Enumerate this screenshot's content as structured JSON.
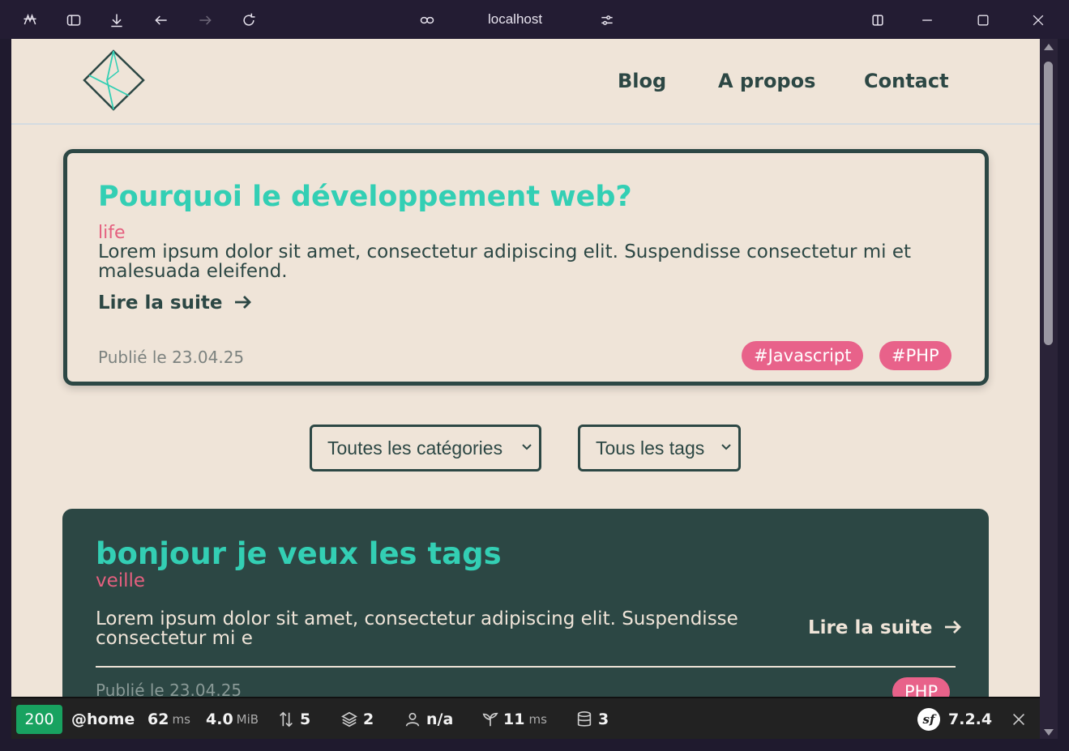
{
  "browser": {
    "url": "localhost",
    "icons": [
      "app-icon",
      "sidebar-icon",
      "download-icon",
      "back-arrow-icon",
      "forward-arrow-icon",
      "reload-icon",
      "link-icon",
      "site-settings-icon",
      "split-view-icon",
      "minimize-icon",
      "maximize-icon",
      "close-icon"
    ]
  },
  "site": {
    "nav": [
      "Blog",
      "A propos",
      "Contact"
    ],
    "colors": {
      "accent": "#33cfb4",
      "pink": "#e8628a",
      "dark": "#2c4744",
      "background": "#efe4d8"
    }
  },
  "featured": {
    "title": "Pourquoi le développement web?",
    "category": "life",
    "excerpt": "Lorem ipsum dolor sit amet, consectetur adipiscing elit. Suspendisse consectetur mi et malesuada eleifend.",
    "read_more": "Lire la suite",
    "date": "Publié le 23.04.25",
    "tags": [
      "#Javascript",
      "#PHP"
    ]
  },
  "filters": {
    "categories": "Toutes les catégories",
    "tags": "Tous les tags"
  },
  "post": {
    "title": "bonjour je veux les tags",
    "category": "veille",
    "excerpt": "Lorem ipsum dolor sit amet, consectetur adipiscing elit. Suspendisse consectetur mi e",
    "read_more": "Lire la suite",
    "date": "Publié le 23.04.25",
    "tag": "PHP"
  },
  "toolbar": {
    "status": "200",
    "route": "@home",
    "time": "62",
    "time_unit": "ms",
    "memory": "4.0",
    "memory_unit": "MiB",
    "requests": "5",
    "layers": "2",
    "user": "n/a",
    "twig_time": "11",
    "twig_unit": "ms",
    "db_queries": "3",
    "version": "7.2.4"
  }
}
